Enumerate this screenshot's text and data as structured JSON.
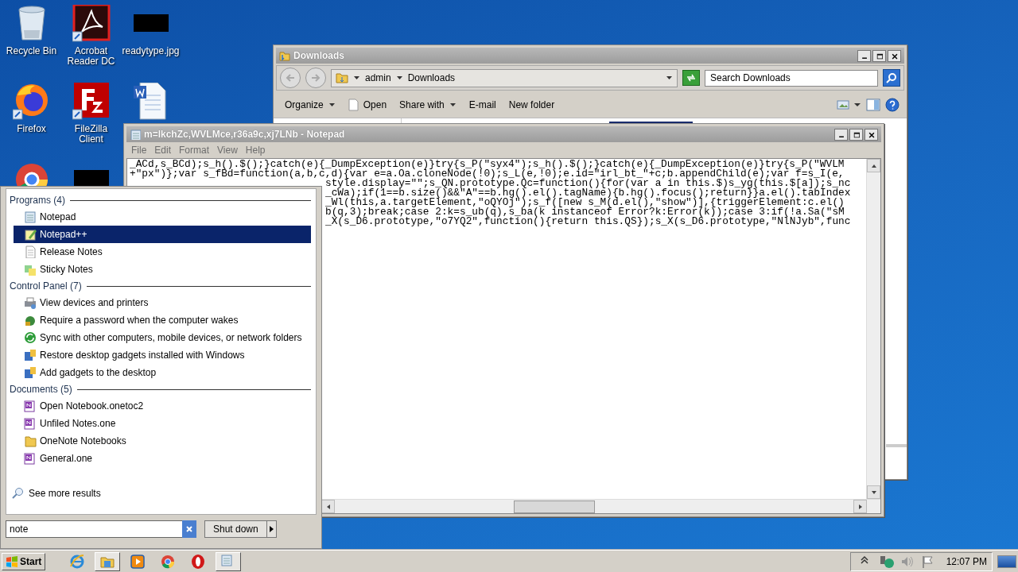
{
  "desktop_icons": [
    {
      "kind": "recycle",
      "label": "Recycle Bin"
    },
    {
      "kind": "pdf",
      "label": "Acrobat Reader DC"
    },
    {
      "kind": "image",
      "label": "readytype.jpg"
    },
    {
      "kind": "firefox",
      "label": "Firefox"
    },
    {
      "kind": "ftp",
      "label": "FileZilla Client"
    },
    {
      "kind": "document"
    },
    {
      "kind": "chrome"
    },
    {
      "kind": "image"
    }
  ],
  "explorer": {
    "title": "Downloads",
    "breadcrumb": [
      "admin",
      "Downloads"
    ],
    "search": {
      "placeholder": "Search Downloads"
    },
    "toolbar": [
      {
        "kind": "menu",
        "label": "Organize"
      },
      {
        "kind": "open",
        "label": "Open"
      },
      {
        "kind": "menu",
        "label": "Share with"
      },
      {
        "kind": "plain",
        "label": "E-mail"
      },
      {
        "kind": "plain",
        "label": "New folder"
      }
    ]
  },
  "notepad": {
    "title": "m=IkchZc,WVLMce,r36a9c,xj7LNb - Notepad",
    "menu": [
      "File",
      "Edit",
      "Format",
      "View",
      "Help"
    ],
    "lines": [
      "_ACd,s_BCd);s_h().$();}catch(e){_DumpException(e)}try{s_P(\"syx4\");s_h().$();}catch(e){_DumpException(e)}try{s_P(\"WVLM",
      "+\"px\")};var s_fBd=function(a,b,c,d){var e=a.Oa.cloneNode(!0);s_L(e,!0);e.id=\"irl_bt_\"+c;b.appendChild(e);var f=s_I(e,",
      "style.display=\"\";s_QN.prototype.Qc=function(){for(var a in this.$)s_yg(this.$[a]);s_nc",
      "_cWa);if(1==b.size()&&\"A\"==b.hg().el().tagName){b.hg().focus();return}}a.el().tabIndex",
      "_Wl(this,a.targetElement,\"oQYOj\");s_f([new s_M(d.el(),\"show\")],{triggerElement:c.el()",
      "b(q,3);break;case 2:k=s_ub(q),s_ba(k instanceof Error?k:Error(k));case 3:if(!a.Sa(\"sM",
      "_X(s_D6.prototype,\"o7YQ2\",function(){return this.QS});s_X(s_D6.prototype,\"NlNJyb\",func"
    ]
  },
  "start_menu": {
    "groups": [
      {
        "title": "Programs (4)",
        "items": [
          {
            "kind": "notepad",
            "label": "Notepad",
            "selected": false
          },
          {
            "kind": "notepadpp",
            "label": "Notepad++",
            "selected": true
          },
          {
            "kind": "text",
            "label": "Release Notes",
            "selected": false
          },
          {
            "kind": "sticky",
            "label": "Sticky Notes",
            "selected": false
          }
        ]
      },
      {
        "title": "Control Panel (7)",
        "items": [
          {
            "kind": "printer",
            "label": "View devices and printers",
            "selected": false
          },
          {
            "kind": "lock",
            "label": "Require a password when the computer wakes",
            "selected": false
          },
          {
            "kind": "sync",
            "label": "Sync with other computers, mobile devices, or network folders",
            "selected": false
          },
          {
            "kind": "gadget",
            "label": "Restore desktop gadgets installed with Windows",
            "selected": false
          },
          {
            "kind": "gadget",
            "label": "Add gadgets to the desktop",
            "selected": false
          }
        ]
      },
      {
        "title": "Documents (5)",
        "items": [
          {
            "kind": "onenote",
            "label": "Open Notebook.onetoc2",
            "selected": false
          },
          {
            "kind": "onenote",
            "label": "Unfiled Notes.one",
            "selected": false
          },
          {
            "kind": "folder",
            "label": "OneNote Notebooks",
            "selected": false
          },
          {
            "kind": "onenote",
            "label": "General.one",
            "selected": false
          }
        ]
      }
    ],
    "more": "See more results",
    "search": {
      "value": "note"
    },
    "shutdown": "Shut down"
  },
  "taskbar": {
    "start": "Start",
    "buttons": [
      {
        "kind": "ie",
        "active": false
      },
      {
        "kind": "explorer",
        "active": true
      },
      {
        "kind": "media",
        "active": false
      },
      {
        "kind": "chrome",
        "active": false
      },
      {
        "kind": "opera",
        "active": false
      },
      {
        "kind": "notepad",
        "active": true
      }
    ],
    "clock": "12:07 PM"
  }
}
